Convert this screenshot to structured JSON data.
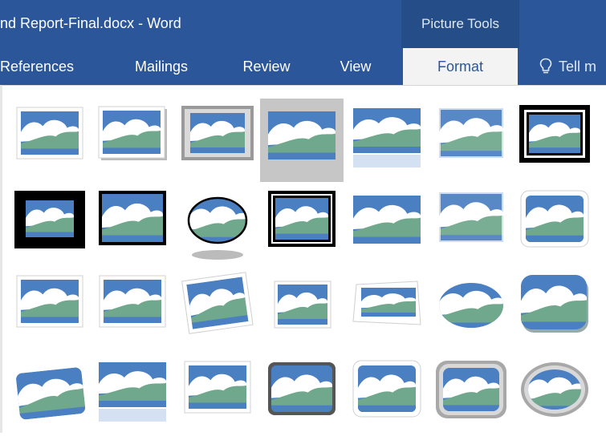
{
  "window": {
    "doc_title": "nd Report-Final.docx - Word",
    "contextual_group": "Picture Tools"
  },
  "ribbon": {
    "tabs": [
      {
        "label": "References",
        "active": false
      },
      {
        "label": "Mailings",
        "active": false
      },
      {
        "label": "Review",
        "active": false
      },
      {
        "label": "View",
        "active": false
      },
      {
        "label": "Format",
        "active": true
      }
    ],
    "tell_me": "Tell m",
    "tell_me_icon": "lightbulb-icon"
  },
  "gallery": {
    "name": "picture-styles",
    "selected_index": 3,
    "styles": [
      "simple-frame-white",
      "beveled-matte-white",
      "metal-frame",
      "rectangle-shadow",
      "reflected-rounded-rectangle",
      "soft-edge-rectangle",
      "double-frame-black",
      "thick-matte-black",
      "simple-frame-black",
      "beveled-oval-black",
      "compound-frame-black",
      "center-shadow-rectangle",
      "soft-edge-rounded",
      "rounded-diagonal-corner-white",
      "snip-diagonal-corner-white",
      "moderate-frame-white",
      "rotated-white",
      "perspective-shadow-white",
      "relaxed-perspective-white",
      "soft-edge-oval",
      "drop-shadow-rounded",
      "reflected-bevel-white",
      "reflected-bevel-black",
      "perspective-white-frame",
      "metal-rounded-rectangle",
      "reflected-rounded-frame",
      "bevel-rectangle",
      "metal-oval"
    ]
  },
  "colors": {
    "ribbon_blue": "#2b579a",
    "sky": "#4a7fc2",
    "hill": "#6fa88c",
    "cloud": "#ffffff"
  }
}
